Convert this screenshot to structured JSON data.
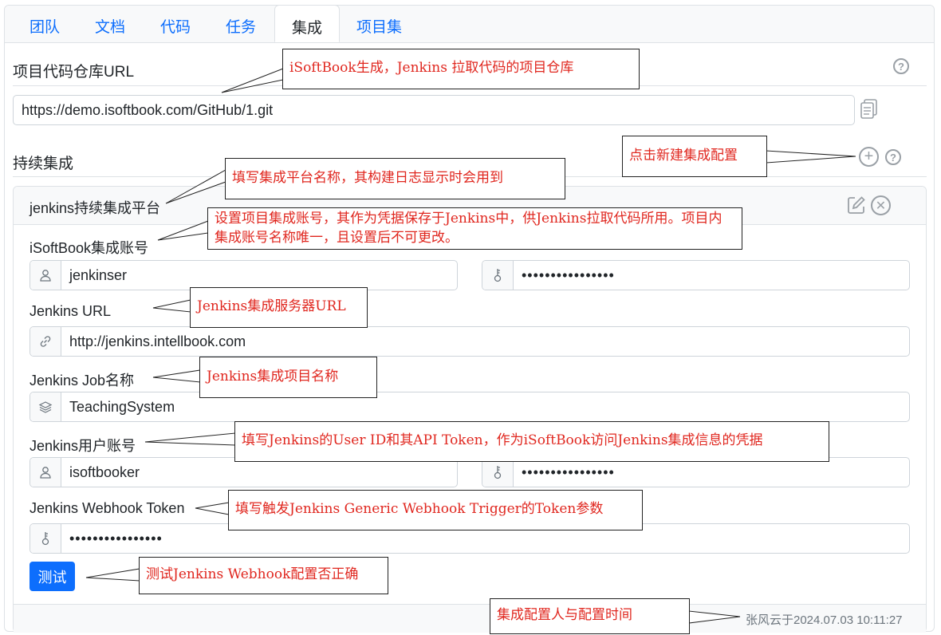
{
  "tabs": [
    {
      "label": "团队"
    },
    {
      "label": "文档"
    },
    {
      "label": "代码"
    },
    {
      "label": "任务"
    },
    {
      "label": "集成",
      "active": true
    },
    {
      "label": "项目集"
    }
  ],
  "repo": {
    "title": "项目代码仓库URL",
    "url": "https://demo.isoftbook.com/GitHub/1.git"
  },
  "ci": {
    "title": "持续集成",
    "platform_name": "jenkins持续集成平台",
    "account_label": "iSoftBook集成账号",
    "account_user": "jenkinser",
    "account_password": "••••••••••••••••",
    "jenkins_url_label": "Jenkins URL",
    "jenkins_url": "http://jenkins.intellbook.com",
    "job_label": "Jenkins Job名称",
    "job_name": "TeachingSystem",
    "user_label": "Jenkins用户账号",
    "jenkins_user": "isoftbooker",
    "jenkins_token": "••••••••••••••••",
    "webhook_label": "Jenkins Webhook Token",
    "webhook_token": "••••••••••••••••",
    "test_button": "测试",
    "footer": "张风云于2024.07.03 10:11:27"
  },
  "callouts": {
    "repo": "iSoftBook生成，Jenkins 拉取代码的项目仓库",
    "add_config": "点击新建集成配置",
    "platform": "填写集成平台名称，其构建日志显示时会用到",
    "account": "设置项目集成账号，其作为凭据保存于Jenkins中，供Jenkins拉取代码所用。项目内集成账号名称唯一，且设置后不可更改。",
    "jenkins_url": "Jenkins集成服务器URL",
    "job": "Jenkins集成项目名称",
    "user": "填写Jenkins的User ID和其API Token，作为iSoftBook访问Jenkins集成信息的凭据",
    "webhook": "填写触发Jenkins Generic Webhook Trigger的Token参数",
    "test": "测试Jenkins Webhook配置否正确",
    "footer": "集成配置人与配置时间"
  },
  "icons": {
    "help": "help-circle-icon",
    "copy": "copy-icon",
    "add": "plus-circle-icon",
    "edit": "edit-icon",
    "close": "close-circle-icon",
    "user": "user-icon",
    "key": "key-icon",
    "link": "link-icon",
    "layers": "layers-icon"
  },
  "colors": {
    "accent": "#0d6efd",
    "callout_text": "#e0271f"
  }
}
